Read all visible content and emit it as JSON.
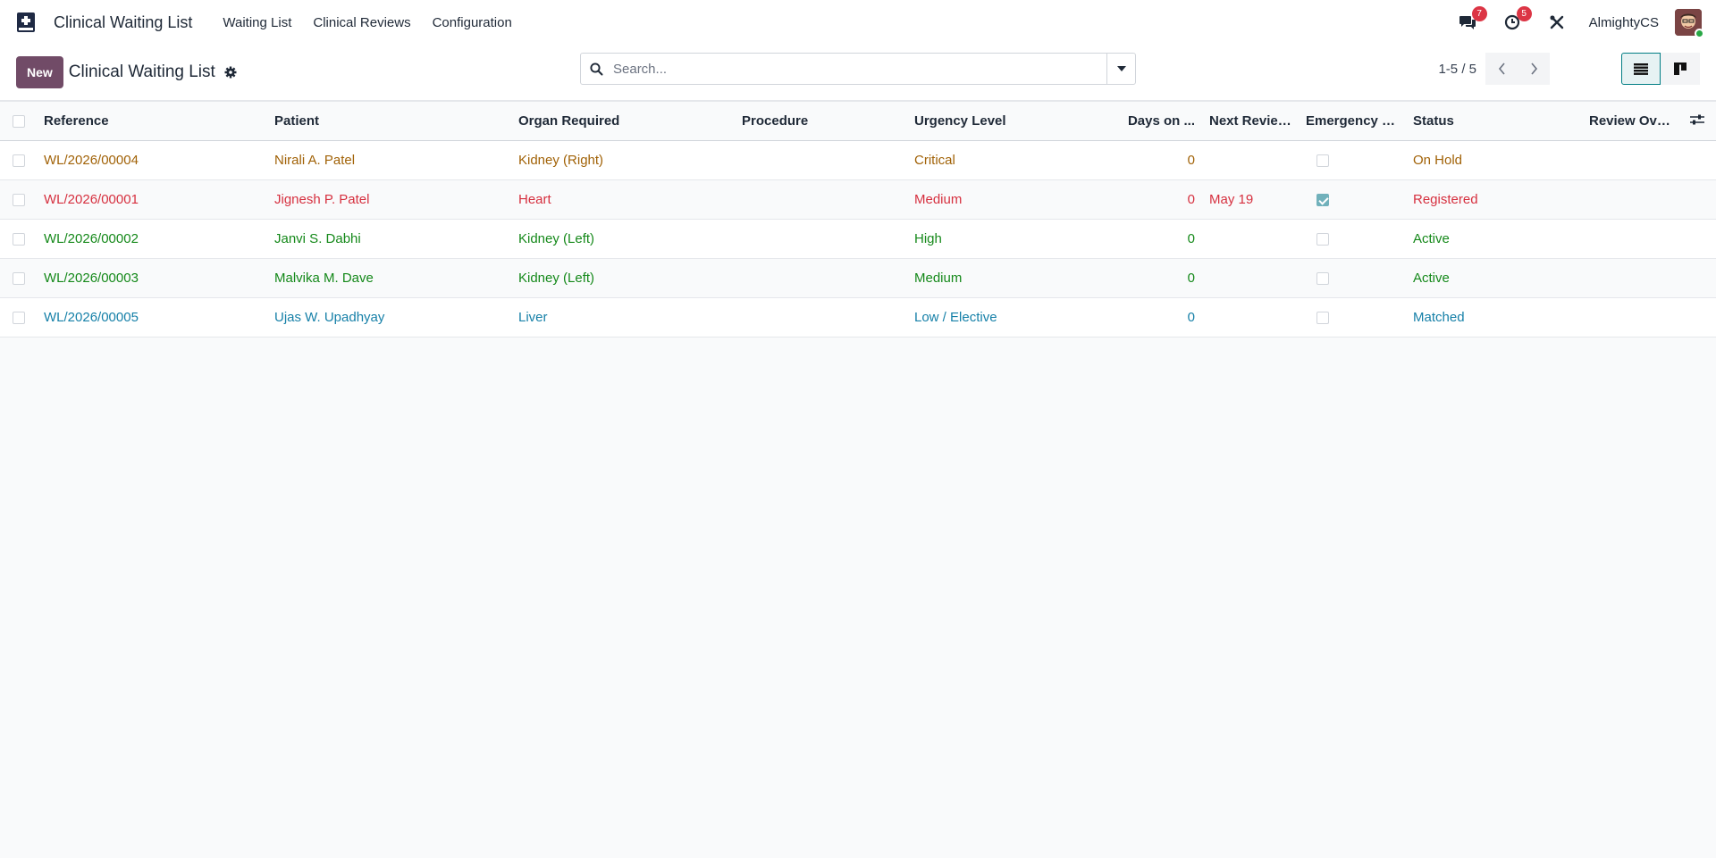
{
  "app": {
    "name": "Clinical Waiting List",
    "menu": [
      "Waiting List",
      "Clinical Reviews",
      "Configuration"
    ],
    "notifications": {
      "messages_count": "7",
      "activities_count": "5"
    },
    "user": "AlmightyCS"
  },
  "control_panel": {
    "new_label": "New",
    "title": "Clinical Waiting List",
    "search_placeholder": "Search...",
    "pager": "1-5 / 5"
  },
  "table": {
    "headers": {
      "reference": "Reference",
      "patient": "Patient",
      "organ": "Organ Required",
      "procedure": "Procedure",
      "urgency": "Urgency Level",
      "days": "Days on ...",
      "next_review": "Next Review...",
      "emergency": "Emergency / ...",
      "status": "Status",
      "review_overdue": "Review Overd..."
    },
    "rows": [
      {
        "reference": "WL/2026/00004",
        "patient": "Nirali A. Patel",
        "organ": "Kidney (Right)",
        "procedure": "",
        "urgency": "Critical",
        "days": "0",
        "next_review": "",
        "emergency": false,
        "status": "On Hold",
        "review_overdue": "",
        "color": "#a16207"
      },
      {
        "reference": "WL/2026/00001",
        "patient": "Jignesh P. Patel",
        "organ": "Heart",
        "procedure": "",
        "urgency": "Medium",
        "days": "0",
        "next_review": "May 19",
        "emergency": true,
        "status": "Registered",
        "review_overdue": "",
        "color": "#d6303f"
      },
      {
        "reference": "WL/2026/00002",
        "patient": "Janvi S. Dabhi",
        "organ": "Kidney (Left)",
        "procedure": "",
        "urgency": "High",
        "days": "0",
        "next_review": "",
        "emergency": false,
        "status": "Active",
        "review_overdue": "",
        "color": "#15891a"
      },
      {
        "reference": "WL/2026/00003",
        "patient": "Malvika M. Dave",
        "organ": "Kidney (Left)",
        "procedure": "",
        "urgency": "Medium",
        "days": "0",
        "next_review": "",
        "emergency": false,
        "status": "Active",
        "review_overdue": "",
        "color": "#15891a"
      },
      {
        "reference": "WL/2026/00005",
        "patient": "Ujas W. Upadhyay",
        "organ": "Liver",
        "procedure": "",
        "urgency": "Low / Elective",
        "days": "0",
        "next_review": "",
        "emergency": false,
        "status": "Matched",
        "review_overdue": "",
        "color": "#1680a8"
      }
    ]
  },
  "icons": {
    "app": "medical-book-icon",
    "messages": "chat-icon",
    "activities": "clock-icon",
    "debug": "tools-icon",
    "gear": "gear-icon",
    "search": "search-icon",
    "search_toggle": "caret-down-icon",
    "pager_prev": "chevron-left-icon",
    "pager_next": "chevron-right-icon",
    "list_view": "list-view-icon",
    "kanban_view": "kanban-view-icon",
    "optional_columns": "column-settings-icon"
  },
  "colors": {
    "primary": "#714b67",
    "accent": "#017e84",
    "badge": "#dc3545"
  }
}
